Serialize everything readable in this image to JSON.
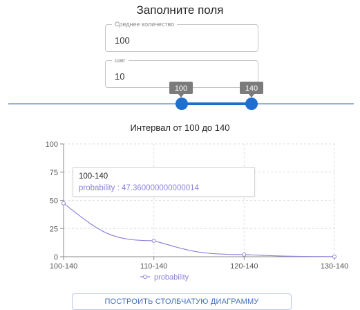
{
  "form": {
    "title": "Заполните поля",
    "mean_field": {
      "label": "Среднее количество",
      "value": "100"
    },
    "step_field": {
      "label": "шаг",
      "value": "10"
    }
  },
  "slider": {
    "low": 100,
    "high": 140,
    "low_label": "100",
    "high_label": "140",
    "color": "#1e6fd0",
    "rail_color": "#8fb3df"
  },
  "interval_title": "Интервал от 100 до 140",
  "chart_data": {
    "type": "line",
    "categories": [
      "100-140",
      "110-140",
      "120-140",
      "130-140"
    ],
    "series": [
      {
        "name": "probability",
        "values": [
          47.36,
          14.2,
          1.9,
          0.1
        ],
        "color": "#8b84d7"
      }
    ],
    "ylim": [
      0,
      100
    ],
    "yticks": [
      0,
      25,
      50,
      75,
      100
    ],
    "grid": true,
    "legend": "bottom"
  },
  "tooltip": {
    "title": "100-140",
    "text": "probability : 47.360000000000014"
  },
  "button_label": "ПОСТРОИТЬ СТОЛБЧАТУЮ ДИАГРАММУ"
}
